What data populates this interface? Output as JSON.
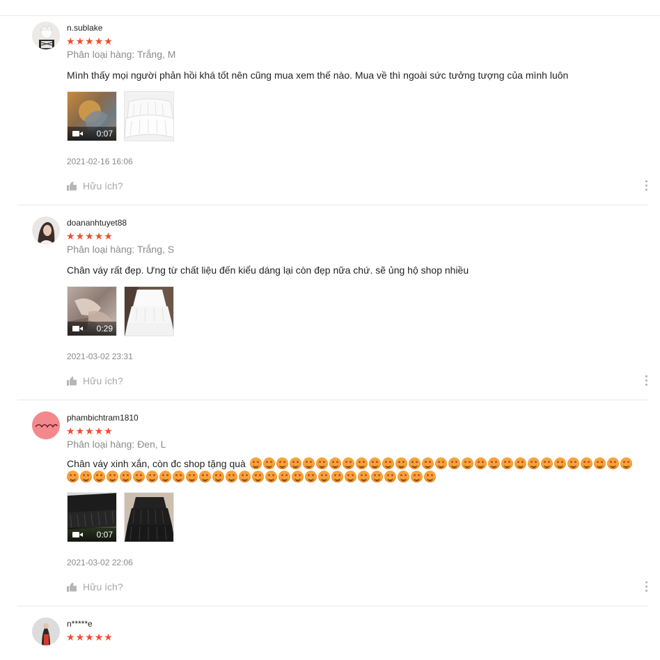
{
  "reviews": [
    {
      "username": "n.sublake",
      "rating": 5,
      "variant": "Phân loại hàng: Trắng, M",
      "comment": "Mình thấy mọi người phản hồi khá tốt nên cũng mua xem thế nào. Mua về thì ngoài sức tưởng tượng của mình luôn",
      "video_duration": "0:07",
      "timestamp": "2021-02-16 16:06",
      "helpful_label": "Hữu ích?"
    },
    {
      "username": "doananhtuyet88",
      "rating": 5,
      "variant": "Phân loại hàng: Trắng, S",
      "comment": "Chân váy rất đẹp. Ưng từ chất liệu đến kiểu dáng lại còn đẹp nữa chứ. sẽ ủng hộ shop nhiều",
      "video_duration": "0:29",
      "timestamp": "2021-03-02 23:31",
      "helpful_label": "Hữu ích?"
    },
    {
      "username": "phambichtram1810",
      "rating": 5,
      "variant": "Phân loại hàng: Đen, L",
      "comment": "Chân váy xinh xắn, còn đc shop tặng quà",
      "emoji_count": 57,
      "emoji_icon": "smiling-face-with-heart-eyes",
      "video_duration": "0:07",
      "timestamp": "2021-03-02 22:06",
      "helpful_label": "Hữu ích?"
    },
    {
      "username": "n*****e",
      "rating": 5
    }
  ],
  "colors": {
    "star": "#ee4d2d",
    "muted_text": "#8a8a8a",
    "separator": "#e8e8e8"
  }
}
